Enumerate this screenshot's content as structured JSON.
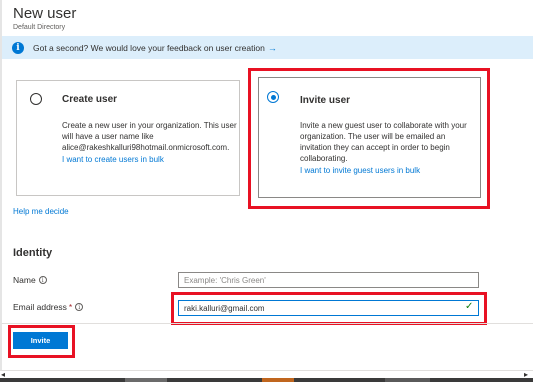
{
  "header": {
    "title": "New user",
    "subtitle": "Default Directory"
  },
  "banner": {
    "text": "Got a second? We would love your feedback on user creation",
    "arrow": "→",
    "icon": "info-icon"
  },
  "options": {
    "create": {
      "title": "Create user",
      "description": "Create a new user in your organization. This user will have a user name like alice@rakeshkalluri98hotmail.onmicrosoft.com.",
      "link": "I want to create users in bulk",
      "selected": false
    },
    "invite": {
      "title": "Invite user",
      "description": "Invite a new guest user to collaborate with your organization. The user will be emailed an invitation they can accept in order to begin collaborating.",
      "link": "I want to invite guest users in bulk",
      "selected": true
    }
  },
  "help_link": "Help me decide",
  "identity": {
    "section_title": "Identity",
    "name": {
      "label": "Name",
      "info_glyph": "i",
      "value": "",
      "placeholder": "Example: 'Chris Green'"
    },
    "email": {
      "label": "Email address",
      "required_marker": "*",
      "info_glyph": "i",
      "value": "raki.kalluri@gmail.com",
      "valid_glyph": "✓"
    }
  },
  "footer": {
    "invite_label": "Invite"
  },
  "scroll": {
    "left_arrow": "◂",
    "right_arrow": "▸"
  },
  "colors": {
    "accent": "#0078d4",
    "highlight": "#e81123",
    "banner_bg": "#dceefb",
    "valid": "#107c10"
  }
}
